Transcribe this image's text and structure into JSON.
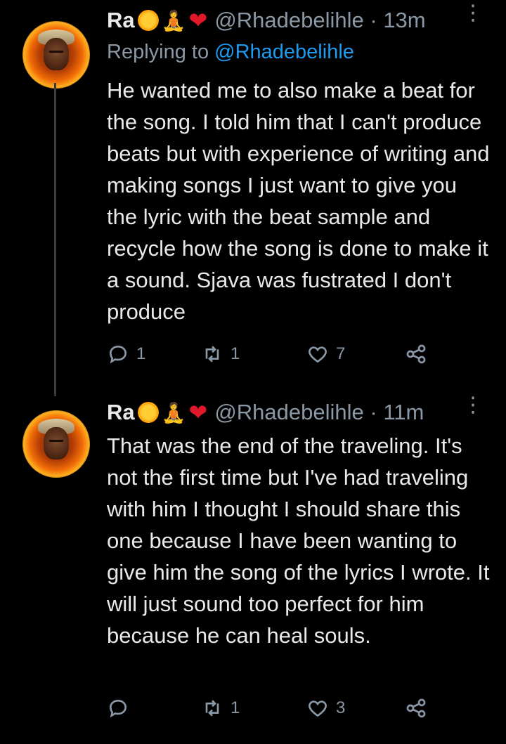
{
  "tweets": [
    {
      "name": "Ra",
      "emojis": [
        "sun-emoji",
        "person-in-lotus-position-emoji",
        "red-heart-emoji"
      ],
      "handle": "@Rhadebelihle · 13m",
      "replying_prefix": "Replying to ",
      "replying_to": "@Rhadebelihle",
      "text": "He wanted me to also make a beat for the song. I told him that I can't produce beats but with experience of writing and making songs I just want to give you the lyric with the beat sample and recycle how the song is done to make it a sound. Sjava was fustrated I don't produce",
      "reply_count": "1",
      "retweet_count": "1",
      "like_count": "7"
    },
    {
      "name": "Ra",
      "emojis": [
        "sun-emoji",
        "person-in-lotus-position-emoji",
        "red-heart-emoji"
      ],
      "handle": "@Rhadebelihle · 11m",
      "text": "That was the end of the traveling. It's not the first time but I've had traveling with him I thought I should share this one because I have been wanting to give him the song of the lyrics I wrote. It will just sound too perfect for him because he can heal souls.",
      "reply_count": "",
      "retweet_count": "1",
      "like_count": "3"
    }
  ],
  "colors": {
    "background": "#000000",
    "text": "#e7e9ea",
    "muted": "#8b98a5",
    "link": "#1d9bf0",
    "thread_line": "#3a3d40"
  }
}
